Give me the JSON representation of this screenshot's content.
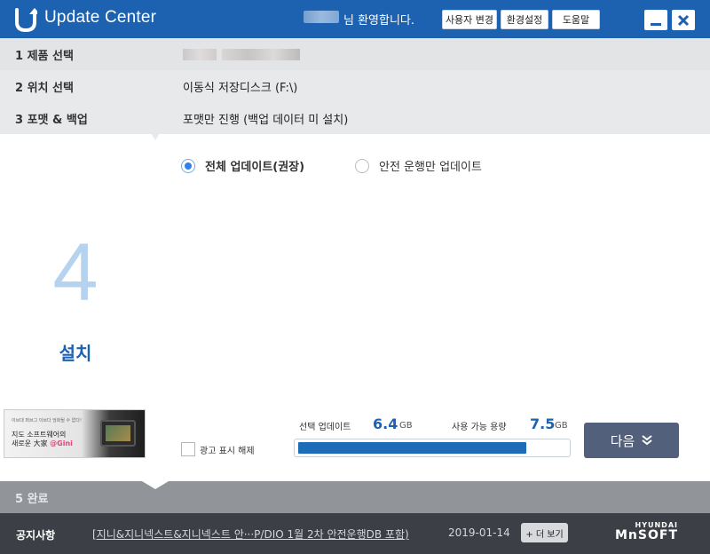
{
  "titlebar": {
    "app_title": "Update Center",
    "welcome": "님 환영합니다.",
    "buttons": [
      "사용자 변경",
      "환경설정",
      "도움말"
    ]
  },
  "steps": [
    {
      "label": "1  제품 선택",
      "value": ""
    },
    {
      "label": "2  위치 선택",
      "value": "이동식 저장디스크 (F:\\)"
    },
    {
      "label": "3  포맷 & 백업",
      "value": "포맷만 진행 (백업 데이터 미 설치)"
    },
    {
      "label": "5  완료",
      "value": ""
    }
  ],
  "current_step": {
    "number": "4",
    "label": "설치"
  },
  "ad": {
    "line1": "이브대 퍼브그 이브다 엉화될 수 없다!",
    "line2": "지도 소프트웨어의",
    "line3": "새로운 大家",
    "brand": "@Gini"
  },
  "options": {
    "full_update": "전체 업데이트(권장)",
    "safe_update": "안전 운행만 업데이트",
    "selected": "full_update"
  },
  "ad_hide": {
    "label": "광고 표시 해제",
    "checked": false
  },
  "stats": {
    "selected_label": "선택 업데이트",
    "selected_value": "6.4",
    "selected_unit": "GB",
    "available_label": "사용 가능 용량",
    "available_value": "7.5",
    "available_unit": "GB",
    "progress_fraction": 0.85
  },
  "next_button": {
    "label": "다음",
    "icon": "double-chevron-down-icon"
  },
  "notice": {
    "title": "공지사항",
    "link": "[지니&지니넥스트&지니넥스트 안···P/DIO 1월 2차 안전운행DB 포함)",
    "date": "2019-01-14",
    "more": "+ 더 보기"
  },
  "brand": {
    "top": "HYUNDAI",
    "bottom": "MnSOFT"
  },
  "colors": {
    "accent": "#1d62b0",
    "next_button": "#53607b",
    "progress": "#1d6cb8"
  }
}
